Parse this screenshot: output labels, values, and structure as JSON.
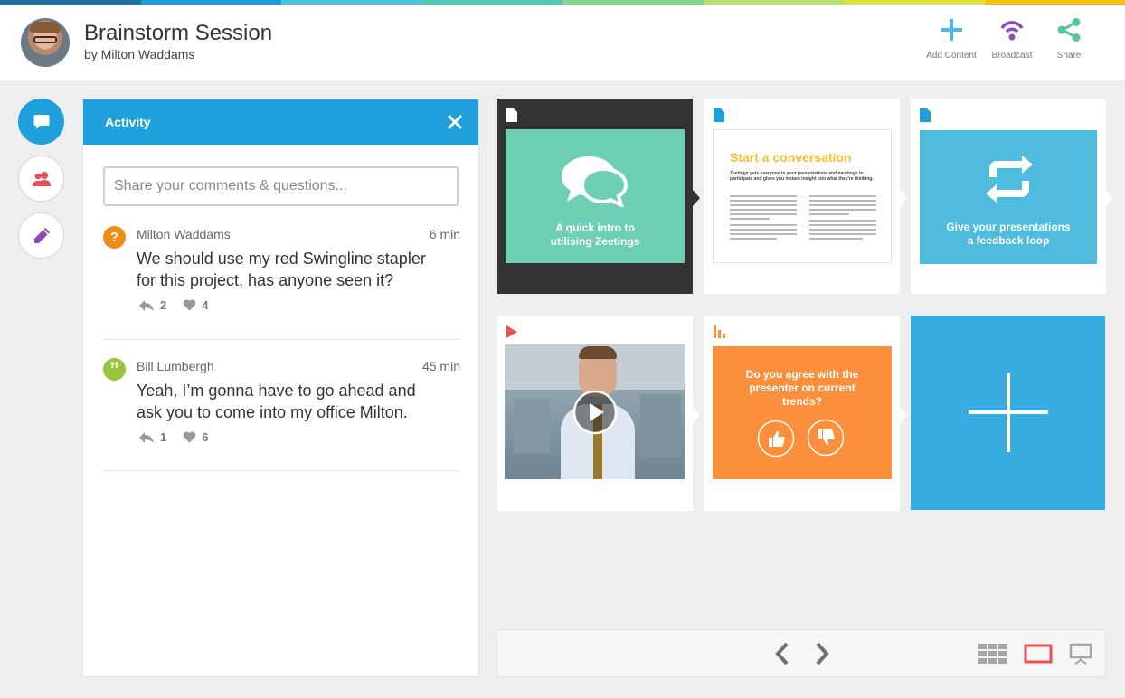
{
  "colors": {
    "stripe": [
      "#1d6fa5",
      "#1aa0d8",
      "#49c4e3",
      "#52c9b5",
      "#7dd88a",
      "#b4e26a",
      "#dfe33f",
      "#f6c20c"
    ],
    "accent_blue": "#1f9fdb",
    "teal": "#6dd0b4",
    "card_blue": "#4fbcde",
    "orange": "#fb8f3b",
    "add_blue": "#36ace0",
    "purple": "#8e4bb3",
    "red": "#e84e56",
    "question_orange": "#f08d16",
    "quote_green": "#9ac43e"
  },
  "header": {
    "title": "Brainstorm Session",
    "subtitle": "by Milton Waddams",
    "avatar_icon": "user-avatar",
    "actions": [
      {
        "label": "Add Content",
        "icon": "plus-icon"
      },
      {
        "label": "Broadcast",
        "icon": "broadcast-icon"
      },
      {
        "label": "Share",
        "icon": "share-icon"
      }
    ]
  },
  "sidebar": {
    "items": [
      {
        "name": "activity",
        "icon": "chat-icon",
        "active": true
      },
      {
        "name": "people",
        "icon": "people-icon",
        "active": false
      },
      {
        "name": "edit",
        "icon": "pencil-icon",
        "active": false
      }
    ]
  },
  "activity": {
    "title": "Activity",
    "close_icon": "close-icon",
    "input_placeholder": "Share your comments & questions...",
    "comments": [
      {
        "author": "Milton Waddams",
        "time": "6 min",
        "text": "We should use my red Swingline stapler for this project, has anyone seen it?",
        "replies": "2",
        "likes": "4",
        "badge": "?",
        "badge_icon": "question-icon"
      },
      {
        "author": "Bill Lumbergh",
        "time": "45 min",
        "text": "Yeah, I’m gonna have to go ahead and ask you to come into my office Milton.",
        "replies": "1",
        "likes": "6",
        "badge": "”",
        "badge_icon": "quote-icon"
      }
    ]
  },
  "cards": [
    {
      "type": "document",
      "type_icon": "document-icon",
      "text": "A quick intro to utilising Zeetings",
      "art_icon": "speech-bubbles-icon",
      "selected": true
    },
    {
      "type": "document",
      "type_icon": "document-icon",
      "doc_title": "Start a conversation",
      "doc_sub": "Zeetings gets everyone in your presentations and meetings to participate and gives you instant insight into what they're thinking."
    },
    {
      "type": "document",
      "type_icon": "document-icon",
      "text": "Give your presentations a feedback loop",
      "art_icon": "refresh-icon"
    },
    {
      "type": "video",
      "type_icon": "play-icon",
      "art_icon": "video-play-icon"
    },
    {
      "type": "poll",
      "type_icon": "bar-chart-icon",
      "text": "Do you agree with the presenter on current trends?",
      "vote_icons": [
        "thumbs-up-icon",
        "thumbs-down-icon"
      ]
    },
    {
      "type": "add",
      "art_icon": "plus-icon"
    }
  ],
  "toolbar": {
    "prev_icon": "chevron-left-icon",
    "next_icon": "chevron-right-icon",
    "views": [
      "grid-view-icon",
      "single-view-icon",
      "present-view-icon"
    ]
  }
}
